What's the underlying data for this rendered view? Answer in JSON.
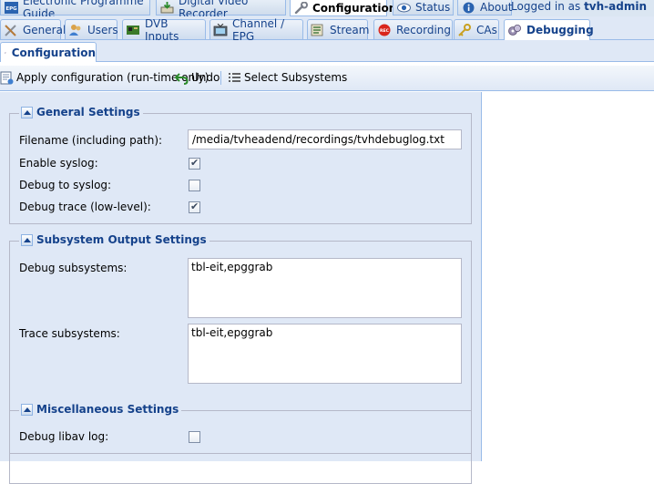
{
  "top_tabs": [
    {
      "label": "Electronic Programme Guide",
      "icon": "epg-icon",
      "badge": "EPG"
    },
    {
      "label": "Digital Video Recorder",
      "icon": "dvr-icon"
    },
    {
      "label": "Configuration",
      "icon": "wrench-icon",
      "active": true
    },
    {
      "label": "Status",
      "icon": "eye-icon"
    },
    {
      "label": "About",
      "icon": "info-icon"
    }
  ],
  "user": {
    "prefix": "Logged in as ",
    "name": "tvh-admin"
  },
  "config_tabs": [
    {
      "label": "General",
      "icon": "tools-icon"
    },
    {
      "label": "Users",
      "icon": "users-icon"
    },
    {
      "label": "DVB Inputs",
      "icon": "dvb-card-icon"
    },
    {
      "label": "Channel / EPG",
      "icon": "tv-icon"
    },
    {
      "label": "Stream",
      "icon": "stream-icon"
    },
    {
      "label": "Recording",
      "icon": "rec-icon",
      "badge": "REC"
    },
    {
      "label": "CAs",
      "icon": "key-icon"
    },
    {
      "label": "Debugging",
      "icon": "bug-icon",
      "active": true
    }
  ],
  "sub_tab": {
    "label": "Configuration",
    "icon": "gear-icon"
  },
  "toolbar": {
    "apply_label": "Apply configuration (run-time only)",
    "undo_label": "Undo",
    "subsystems_label": "Select Subsystems"
  },
  "general": {
    "title": "General Settings",
    "filename_label": "Filename (including path):",
    "filename_value": "/media/tvheadend/recordings/tvhdebuglog.txt",
    "syslog_label": "Enable syslog:",
    "syslog_checked": true,
    "debug_syslog_label": "Debug to syslog:",
    "debug_syslog_checked": false,
    "trace_label": "Debug trace (low-level):",
    "trace_checked": true
  },
  "subsystem": {
    "title": "Subsystem Output Settings",
    "debug_label": "Debug subsystems:",
    "debug_value": "tbl-eit,epggrab",
    "trace_label": "Trace subsystems:",
    "trace_value": "tbl-eit,epggrab"
  },
  "misc": {
    "title": "Miscellaneous Settings",
    "libav_label": "Debug libav log:",
    "libav_checked": false
  },
  "colors": {
    "accent": "#15428b",
    "panel": "#dfe8f6",
    "border": "#99bbe8"
  }
}
